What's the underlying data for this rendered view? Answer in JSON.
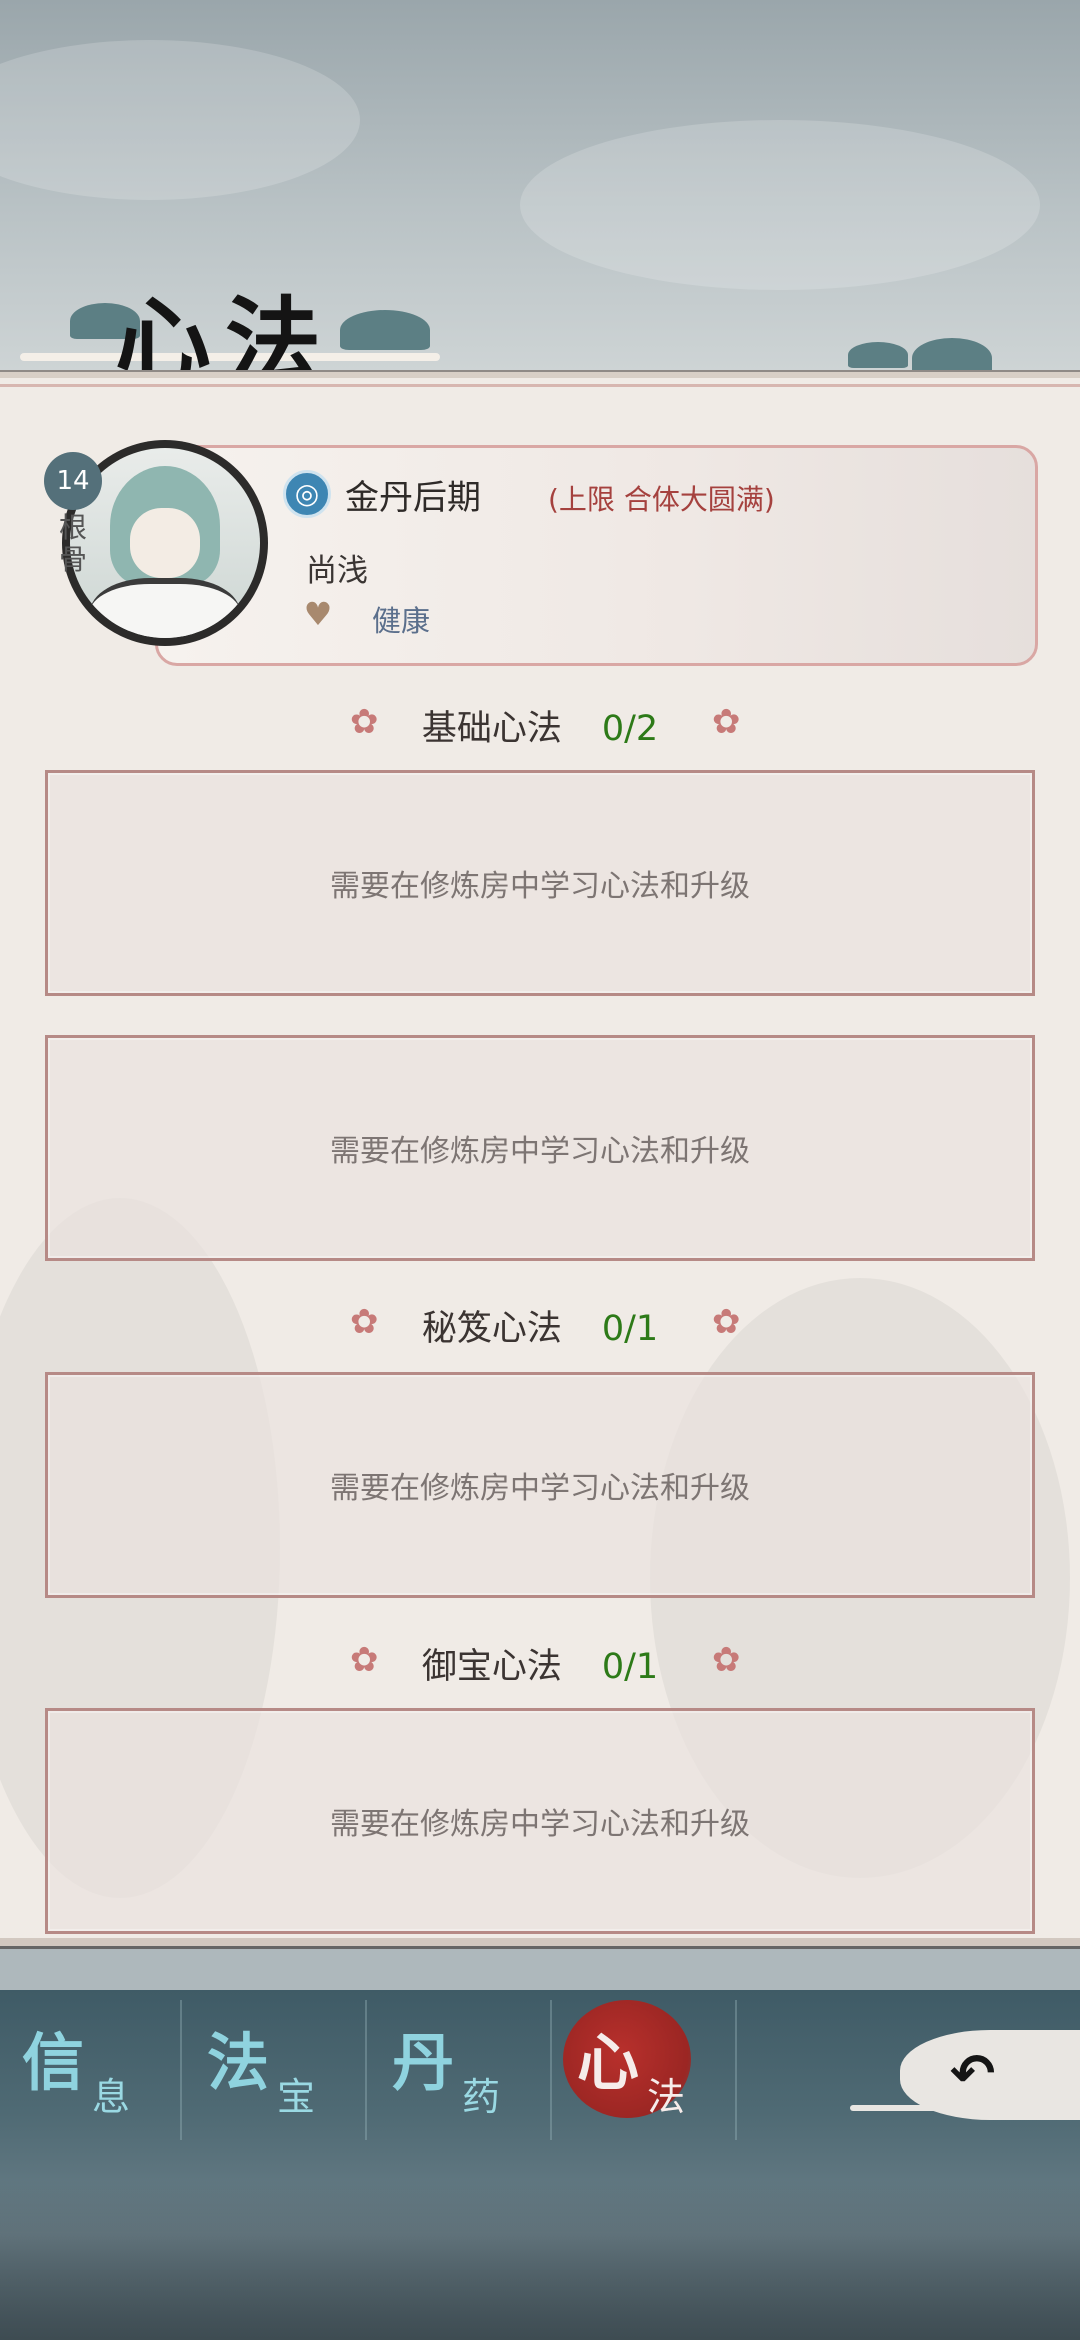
{
  "header": {
    "title": "心法"
  },
  "character": {
    "root_bone_value": "14",
    "root_bone_label": "根骨",
    "realm": "金丹后期",
    "realm_cap": "(上限 合体大圆满)",
    "state": "尚浅",
    "health_status": "健康"
  },
  "sections": [
    {
      "title": "基础心法",
      "count": "0/2",
      "slots": [
        "需要在修炼房中学习心法和升级",
        "需要在修炼房中学习心法和升级"
      ]
    },
    {
      "title": "秘笈心法",
      "count": "0/1",
      "slots": [
        "需要在修炼房中学习心法和升级"
      ]
    },
    {
      "title": "御宝心法",
      "count": "0/1",
      "slots": [
        "需要在修炼房中学习心法和升级"
      ]
    }
  ],
  "tabs": [
    {
      "big": "信",
      "small": "息",
      "active": false
    },
    {
      "big": "法",
      "small": "宝",
      "active": false
    },
    {
      "big": "丹",
      "small": "药",
      "active": false
    },
    {
      "big": "心",
      "small": "法",
      "active": true
    }
  ],
  "colors": {
    "accent_red": "#9b2623",
    "tab_text": "#8fd3df",
    "count_green": "#2d7a18",
    "cap_red": "#a5413e"
  },
  "icons": {
    "realm": "realm-swirl-icon",
    "health": "heart-plus-icon",
    "back": "back-arrow-icon",
    "flower": "flower-icon"
  }
}
